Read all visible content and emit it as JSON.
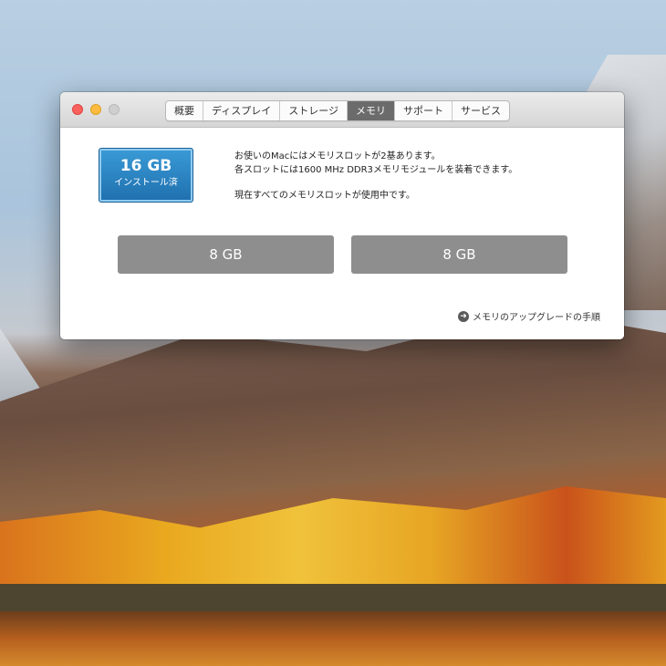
{
  "window": {
    "tabs": [
      {
        "label": "概要",
        "active": false
      },
      {
        "label": "ディスプレイ",
        "active": false
      },
      {
        "label": "ストレージ",
        "active": false
      },
      {
        "label": "メモリ",
        "active": true
      },
      {
        "label": "サポート",
        "active": false
      },
      {
        "label": "サービス",
        "active": false
      }
    ],
    "traffic_lights": {
      "close": "close-icon",
      "minimize": "minimize-icon",
      "zoom": "zoom-icon"
    }
  },
  "memory": {
    "installed_size": "16 GB",
    "installed_label": "インストール済",
    "info_lines": [
      "お使いのMacにはメモリスロットが2基あります。",
      "各スロットには1600 MHz DDR3メモリモジュールを装着できます。"
    ],
    "status_line": "現在すべてのメモリスロットが使用中です。",
    "slots": [
      "8 GB",
      "8 GB"
    ],
    "upgrade_link": "メモリのアップグレードの手順",
    "upgrade_icon": "arrow-right-circle-icon"
  },
  "colors": {
    "installed_box": "#2a86c6",
    "slot": "#8e8e8e",
    "active_tab": "#6b6b6b"
  }
}
